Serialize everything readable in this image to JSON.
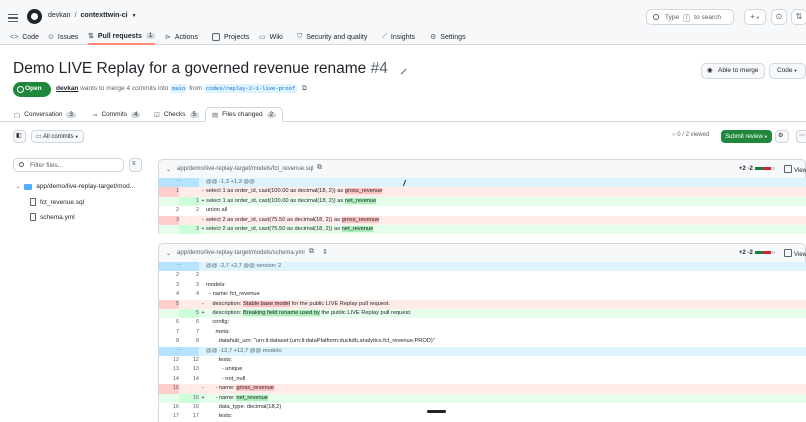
{
  "header": {
    "owner": "devkan",
    "separator": "/",
    "repo": "contexttwin-ci",
    "search_placeholder_pre": "Type",
    "search_key": "/",
    "search_placeholder_post": "to search",
    "plus_label": "+",
    "tabs": [
      {
        "label": "Code",
        "count": ""
      },
      {
        "label": "Issues",
        "count": ""
      },
      {
        "label": "Pull requests",
        "count": "1"
      },
      {
        "label": "Actions",
        "count": ""
      },
      {
        "label": "Projects",
        "count": ""
      },
      {
        "label": "Wiki",
        "count": ""
      },
      {
        "label": "Security and quality",
        "count": ""
      },
      {
        "label": "Insights",
        "count": ""
      },
      {
        "label": "Settings",
        "count": ""
      }
    ]
  },
  "pr": {
    "title": "Demo LIVE Replay for a governed revenue rename",
    "number": "#4",
    "state": "Open",
    "author": "devkan",
    "merge_text": "wants to merge 4 commits into",
    "base_branch": "main",
    "from_text": "from",
    "head_branch": "codex/replay-2-1-live-proof",
    "merge_button": "Able to merge",
    "code_button": "Code",
    "tabs": [
      {
        "label": "Conversation",
        "count": "3"
      },
      {
        "label": "Commits",
        "count": "4"
      },
      {
        "label": "Checks",
        "count": "5"
      },
      {
        "label": "Files changed",
        "count": "2"
      }
    ],
    "all_commits": "All commits",
    "viewed": "0 / 2 viewed",
    "submit_review": "Submit review"
  },
  "tree": {
    "filter_placeholder": "Filter files...",
    "folder": "app/demo/live-replay-target/mod...",
    "files": [
      "fct_revenue.sql",
      "schema.yml"
    ]
  },
  "files": [
    {
      "path": "app/demo/live-replay-target/models/fct_revenue.sql",
      "stat": "+2 -2",
      "viewed_label": "Viewed",
      "lines": [
        {
          "type": "hunk",
          "n1": "",
          "n2": "",
          "sign": "",
          "pre": "@@ -1,3 +1,3 @@",
          "hl": "",
          "post": ""
        },
        {
          "type": "del",
          "n1": "1",
          "n2": "",
          "sign": "-",
          "pre": "select 1 as order_id, cast(100.00 as decimal(18, 2)) as ",
          "hl": "gross_revenue",
          "post": ""
        },
        {
          "type": "add",
          "n1": "",
          "n2": "1",
          "sign": "+",
          "pre": "select 1 as order_id, cast(100.00 as decimal(18, 2)) as ",
          "hl": "net_revenue",
          "post": ""
        },
        {
          "type": "ctx",
          "n1": "2",
          "n2": "2",
          "sign": "",
          "pre": "union all",
          "hl": "",
          "post": ""
        },
        {
          "type": "del",
          "n1": "3",
          "n2": "",
          "sign": "-",
          "pre": "select 2 as order_id, cast(75.50 as decimal(18, 2)) as ",
          "hl": "gross_revenue",
          "post": ""
        },
        {
          "type": "add",
          "n1": "",
          "n2": "3",
          "sign": "+",
          "pre": "select 2 as order_id, cast(75.50 as decimal(18, 2)) as ",
          "hl": "net_revenue",
          "post": ""
        }
      ]
    },
    {
      "path": "app/demo/live-replay-target/models/schema.yml",
      "stat": "+2 -2",
      "viewed_label": "Viewe",
      "lines": [
        {
          "type": "hunk",
          "n1": "",
          "n2": "",
          "sign": "",
          "pre": "@@ -2,7 +2,7 @@ version: 2",
          "hl": "",
          "post": ""
        },
        {
          "type": "ctx",
          "n1": "2",
          "n2": "2",
          "sign": "",
          "pre": "",
          "hl": "",
          "post": ""
        },
        {
          "type": "ctx",
          "n1": "3",
          "n2": "3",
          "sign": "",
          "pre": "models:",
          "hl": "",
          "post": ""
        },
        {
          "type": "ctx",
          "n1": "4",
          "n2": "4",
          "sign": "",
          "pre": "  - name: fct_revenue",
          "hl": "",
          "post": ""
        },
        {
          "type": "del",
          "n1": "5",
          "n2": "",
          "sign": "-",
          "pre": "    description: ",
          "hl": "Stable base model",
          "post": " for the public LIVE Replay pull request."
        },
        {
          "type": "add",
          "n1": "",
          "n2": "5",
          "sign": "+",
          "pre": "    description: ",
          "hl": "Breaking field rename used by",
          "post": " the public LIVE Replay pull request."
        },
        {
          "type": "ctx",
          "n1": "6",
          "n2": "6",
          "sign": "",
          "pre": "    config:",
          "hl": "",
          "post": ""
        },
        {
          "type": "ctx",
          "n1": "7",
          "n2": "7",
          "sign": "",
          "pre": "      meta:",
          "hl": "",
          "post": ""
        },
        {
          "type": "ctx",
          "n1": "8",
          "n2": "8",
          "sign": "",
          "pre": "        datahub_urn: \"urn:li:dataset:(urn:li:dataPlatform:duckdb,analytics.fct_revenue,PROD)\"",
          "hl": "",
          "post": ""
        },
        {
          "type": "hunk",
          "n1": "",
          "n2": "",
          "sign": "",
          "pre": "@@ -12,7 +12,7 @@ models:",
          "hl": "",
          "post": ""
        },
        {
          "type": "ctx",
          "n1": "12",
          "n2": "12",
          "sign": "",
          "pre": "        tests:",
          "hl": "",
          "post": ""
        },
        {
          "type": "ctx",
          "n1": "13",
          "n2": "13",
          "sign": "",
          "pre": "          - unique",
          "hl": "",
          "post": ""
        },
        {
          "type": "ctx",
          "n1": "14",
          "n2": "14",
          "sign": "",
          "pre": "          - not_null",
          "hl": "",
          "post": ""
        },
        {
          "type": "del",
          "n1": "15",
          "n2": "",
          "sign": "-",
          "pre": "      - name: ",
          "hl": "gross_revenue",
          "post": ""
        },
        {
          "type": "add",
          "n1": "",
          "n2": "15",
          "sign": "+",
          "pre": "      - name: ",
          "hl": "net_revenue",
          "post": ""
        },
        {
          "type": "ctx",
          "n1": "16",
          "n2": "16",
          "sign": "",
          "pre": "        data_type: decimal(18,2)",
          "hl": "",
          "post": ""
        },
        {
          "type": "ctx",
          "n1": "17",
          "n2": "17",
          "sign": "",
          "pre": "        tests:",
          "hl": "",
          "post": ""
        }
      ]
    }
  ],
  "colors": {
    "accent": "#1f883d",
    "link": "#0969da",
    "del": "#ffebe9",
    "add": "#e6ffec",
    "hunk": "#ddf4ff"
  }
}
